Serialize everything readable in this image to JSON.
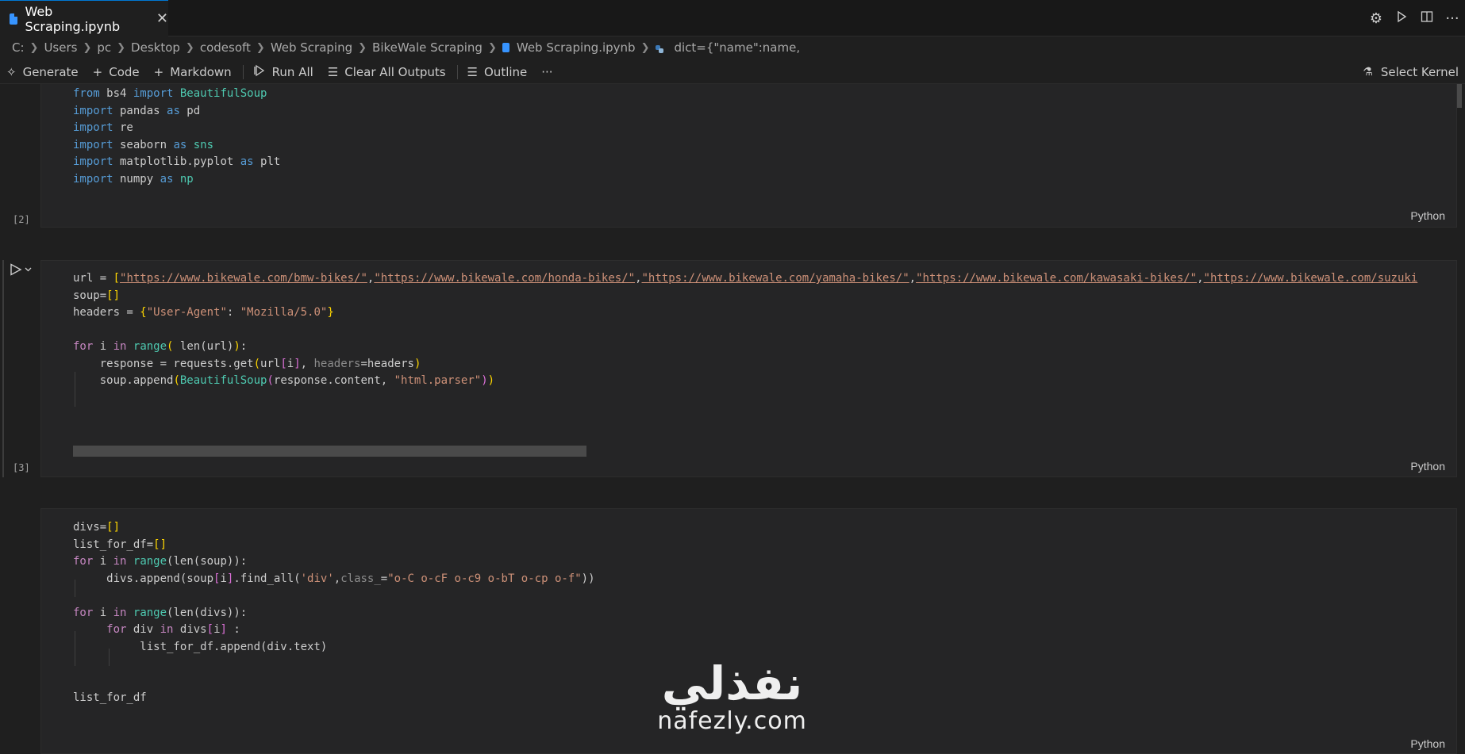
{
  "tab": {
    "title": "Web Scraping.ipynb",
    "close": "✕"
  },
  "tab_actions": [
    "gear-icon",
    "run-icon",
    "split-editor-icon",
    "more-icon"
  ],
  "breadcrumbs": [
    "C:",
    "Users",
    "pc",
    "Desktop",
    "codesoft",
    "Web Scraping",
    "BikeWale Scraping",
    "Web Scraping.ipynb",
    "dict={\"name\":name,"
  ],
  "toolbar": {
    "generate": "Generate",
    "code": "Code",
    "markdown": "Markdown",
    "run_all": "Run All",
    "clear_all": "Clear All Outputs",
    "outline": "Outline",
    "more": "···",
    "select_kernel": "Select Kernel"
  },
  "cells": [
    {
      "exec": "[2]",
      "lang": "Python"
    },
    {
      "exec": "[3]",
      "lang": "Python"
    },
    {
      "exec": "",
      "lang": "Python"
    }
  ],
  "code": {
    "c1": {
      "l1_kw": "from",
      "l1_mod": " bs4 ",
      "l1_kw2": "import",
      "l1_cls": " BeautifulSoup",
      "l2_kw": "import",
      "l2_mod": " pandas ",
      "l2_kw2": "as",
      "l2_alias": " pd",
      "l3_kw": "import",
      "l3_mod": " re",
      "l4_kw": "import",
      "l4_mod": " seaborn ",
      "l4_kw2": "as",
      "l4_alias": " sns",
      "l5_kw": "import",
      "l5_mod": " matplotlib.pyplot ",
      "l5_kw2": "as",
      "l5_alias": " plt",
      "l6_kw": "import",
      "l6_mod": " numpy ",
      "l6_kw2": "as",
      "l6_alias": " np"
    },
    "c2": {
      "l1_a": "url = ",
      "l1_b": "[",
      "u1": "\"https://www.bikewale.com/bmw-bikes/\"",
      "u2": "\"https://www.bikewale.com/honda-bikes/\"",
      "u3": "\"https://www.bikewale.com/yamaha-bikes/\"",
      "u4": "\"https://www.bikewale.com/kawasaki-bikes/\"",
      "u5": "\"https://www.bikewale.com/suzuki",
      "comma": ",",
      "l2_a": "soup=",
      "l2_b": "[]",
      "l3_a": "headers = ",
      "l3_b": "{",
      "l3_k": "\"User-Agent\"",
      "l3_c": ": ",
      "l3_v": "\"Mozilla/5.0\"",
      "l3_d": "}",
      "l5_for": "for",
      "l5_i": " i ",
      "l5_in": "in",
      "l5_sp": " ",
      "l5_range": "range",
      "l5_p1": "(",
      "l5_mid": " len(url)",
      "l5_p2": ")",
      "l5_end": ":",
      "l6_a": "    response = requests.get",
      "l6_p1": "(",
      "l6_b": "url",
      "l6_br1": "[",
      "l6_i": "i",
      "l6_br2": "]",
      "l6_c": ", ",
      "l6_prm": "headers",
      "l6_d": "=headers",
      "l6_p2": ")",
      "l7_a": "    soup.append",
      "l7_p1": "(",
      "l7_cls": "BeautifulSoup",
      "l7_p2": "(",
      "l7_b": "response.content, ",
      "l7_str": "\"html.parser\"",
      "l7_p3": ")",
      "l7_p4": ")"
    },
    "c3": {
      "l1_a": "divs=",
      "l1_b": "[]",
      "l2_a": "list_for_df=",
      "l2_b": "[]",
      "l3_for": "for",
      "l3_i": " i ",
      "l3_in": "in",
      "l3_sp": " ",
      "l3_range": "range",
      "l3_rest": "(len(soup)):",
      "l4_a": "     divs.append(soup",
      "l4_br1": "[",
      "l4_i": "i",
      "l4_br2": "]",
      "l4_b": ".find_all(",
      "l4_s1": "'div'",
      "l4_c": ",",
      "l4_prm": "class_",
      "l4_d": "=",
      "l4_s2": "\"o-C o-cF o-c9 o-bT o-cp o-f\"",
      "l4_e": "))",
      "l6_for": "for",
      "l6_i": " i ",
      "l6_in": "in",
      "l6_sp": " ",
      "l6_range": "range",
      "l6_rest": "(len(divs)):",
      "l7_sp": "     ",
      "l7_for": "for",
      "l7_div": " div ",
      "l7_in": "in",
      "l7_b": " divs",
      "l7_br1": "[",
      "l7_i": "i",
      "l7_br2": "]",
      "l7_c": " :",
      "l8_a": "          list_for_df.append(div.text)",
      "l11_a": "list_for_df"
    }
  },
  "watermark": {
    "arabic": "نفذلي",
    "latin": "nafezly.com"
  }
}
